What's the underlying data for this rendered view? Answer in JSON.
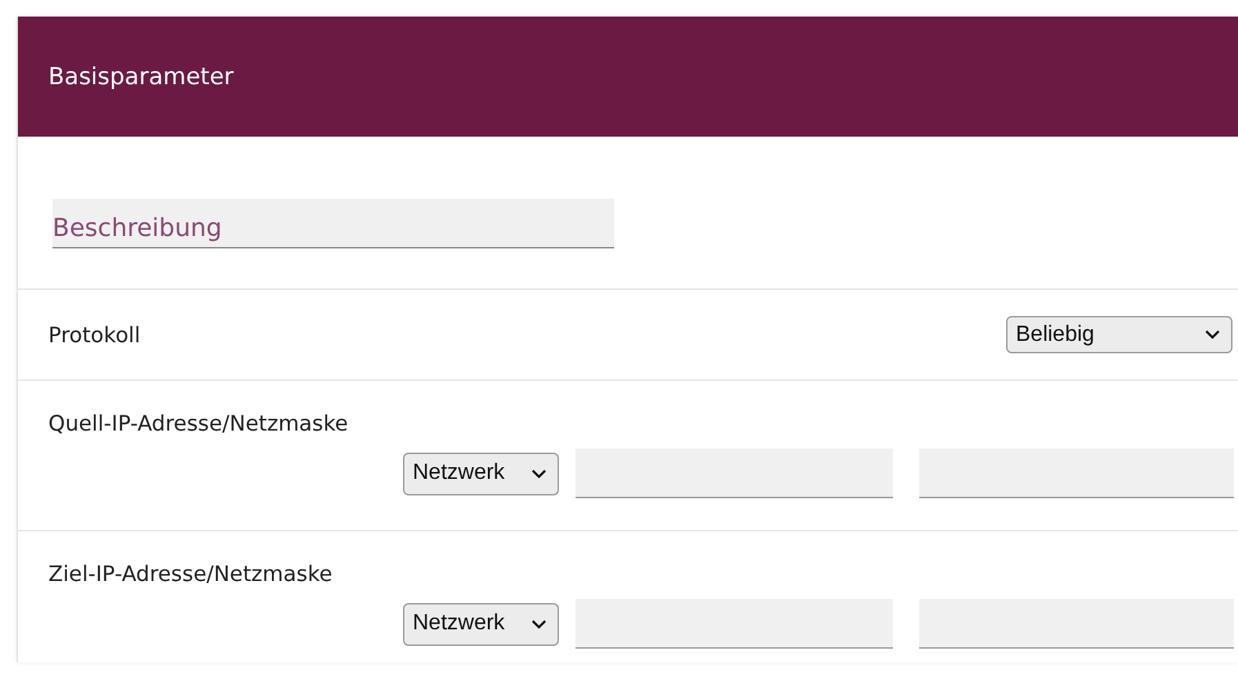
{
  "panel": {
    "title": "Basisparameter"
  },
  "description_field": {
    "placeholder": "Beschreibung"
  },
  "rows": [
    {
      "kind": "select",
      "label": "Protokoll",
      "select_value": "Beliebig"
    },
    {
      "kind": "address",
      "label": "Quell-IP-Adresse/Netzmaske",
      "select_value": "Netzwerk"
    },
    {
      "kind": "address",
      "label": "Ziel-IP-Adresse/Netzmaske",
      "select_value": "Netzwerk"
    }
  ]
}
